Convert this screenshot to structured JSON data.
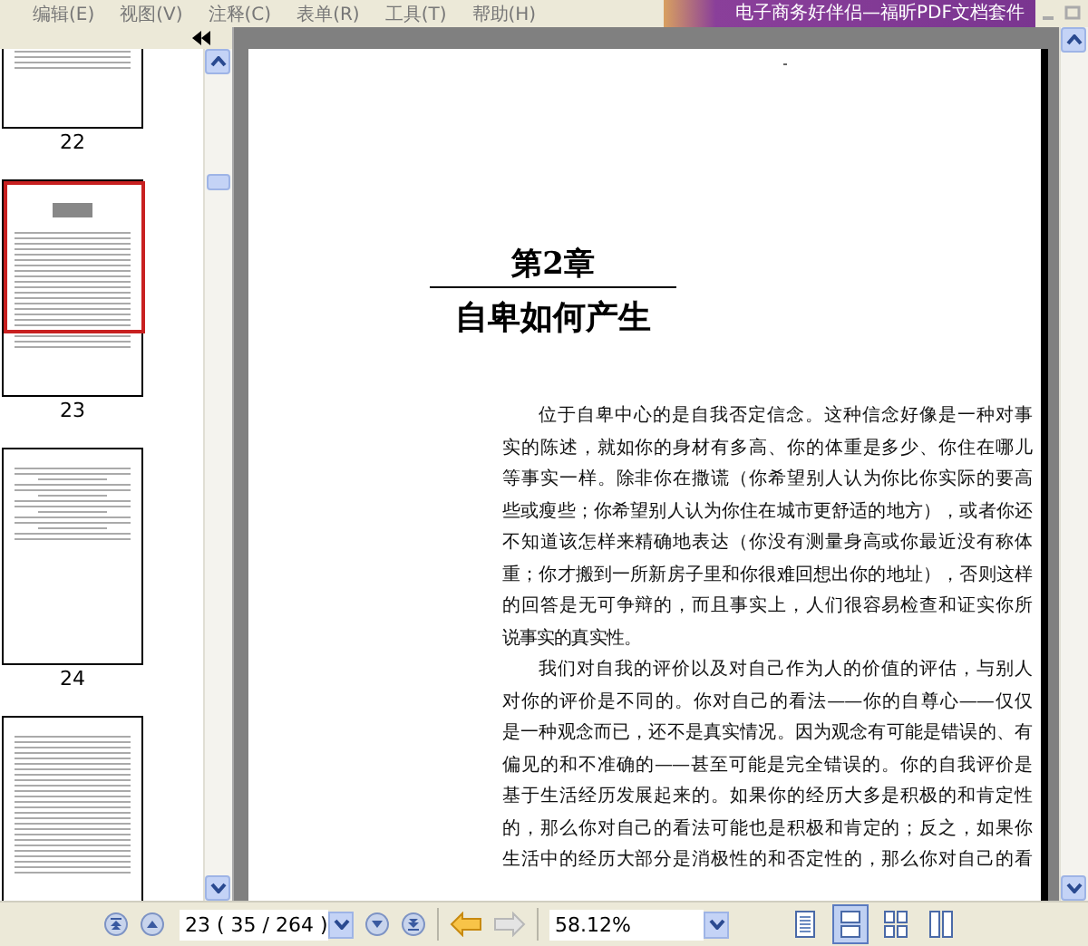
{
  "menu": [
    {
      "label": "编辑(E)"
    },
    {
      "label": "视图(V)"
    },
    {
      "label": "注释(C)"
    },
    {
      "label": "表单(R)"
    },
    {
      "label": "工具(T)"
    },
    {
      "label": "帮助(H)"
    }
  ],
  "banner": "电子商务好伴侣—福昕PDF文档套件",
  "thumbnails": [
    {
      "label": "22",
      "selected": false,
      "kind": "text"
    },
    {
      "label": "23",
      "selected": true,
      "kind": "chapter"
    },
    {
      "label": "24",
      "selected": false,
      "kind": "diagram"
    },
    {
      "selected": false,
      "kind": "text"
    }
  ],
  "document": {
    "chapter": "第2章",
    "title": "自卑如何产生",
    "paragraphs": [
      {
        "lines": [
          "位于自卑中心的是自我否定信念。这种信念好像是一种对事",
          "实的陈述，就如你的身材有多高、你的体重是多少、你住在哪儿",
          "等事实一样。除非你在撒谎（你希望别人认为你比你实际的要高",
          "些或瘦些；你希望别人认为你住在城市更舒适的地方），或者你还",
          "不知道该怎样来精确地表达（你没有测量身高或你最近没有称体",
          "重；你才搬到一所新房子里和你很难回想出你的地址），否则这样",
          "的回答是无可争辩的，而且事实上，人们很容易检查和证实你所",
          "说事实的真实性。"
        ]
      },
      {
        "lines": [
          "我们对自我的评价以及对自己作为人的价值的评估，与别人",
          "对你的评价是不同的。你对自己的看法——你的自尊心——仅仅",
          "是一种观念而已，还不是真实情况。因为观念有可能是错误的、有",
          "偏见的和不准确的——甚至可能是完全错误的。你的自我评价是",
          "基于生活经历发展起来的。如果你的经历大多是积极的和肯定性",
          "的，那么你对自己的看法可能也是积极和肯定的；反之，如果你",
          "生活中的经历大部分是消极性的和否定性的，那么你对自己的看"
        ]
      }
    ]
  },
  "toolbar": {
    "page_field": "23 ( 35 / 264 )",
    "zoom_field": "58.12%",
    "history": [
      {
        "kind": "back",
        "disabled": false
      },
      {
        "kind": "forward",
        "disabled": true
      }
    ],
    "view_modes": [
      {
        "kind": "single",
        "selected": false
      },
      {
        "kind": "continuous",
        "selected": true
      },
      {
        "kind": "facing",
        "selected": false
      },
      {
        "kind": "continuous-facing",
        "selected": false
      }
    ]
  }
}
